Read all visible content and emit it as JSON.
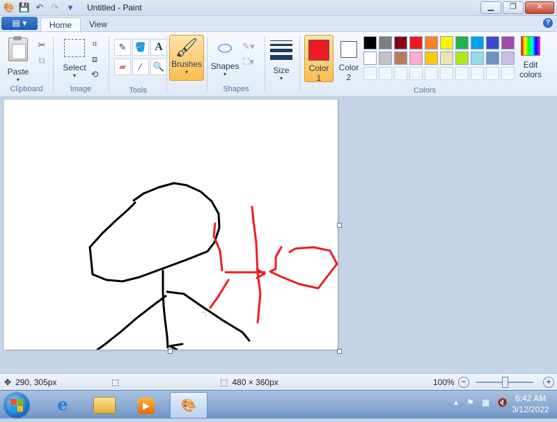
{
  "titlebar": {
    "title": "Untitled - Paint",
    "qat_icons": [
      "paint-app-icon",
      "save-icon",
      "undo-icon",
      "redo-icon",
      "customize-qat-icon"
    ],
    "window_buttons": [
      "minimize",
      "maximize",
      "close"
    ]
  },
  "ribbon_tabs": {
    "menu_icon": "paint-menu",
    "tabs": [
      {
        "label": "Home",
        "active": true
      },
      {
        "label": "View",
        "active": false
      }
    ]
  },
  "groups": {
    "clipboard": {
      "label": "Clipboard",
      "paste_label": "Paste",
      "small_icons": [
        "cut-icon",
        "copy-icon"
      ]
    },
    "image": {
      "label": "Image",
      "select_label": "Select",
      "small_icons": [
        "crop-icon",
        "resize-icon",
        "rotate-icon"
      ]
    },
    "tools": {
      "label": "Tools",
      "icons": [
        "pencil-icon",
        "fill-icon",
        "text-icon",
        "eraser-icon",
        "color-picker-icon",
        "magnifier-icon"
      ]
    },
    "brushes": {
      "label": "Brushes"
    },
    "shapes": {
      "label": "Shapes",
      "button_label": "Shapes"
    },
    "size": {
      "label": "Size"
    },
    "colors": {
      "label": "Colors",
      "color1_label": "Color",
      "color1_num": "1",
      "color2_label": "Color",
      "color2_num": "2",
      "edit_label": "Edit",
      "edit_label2": "colors",
      "color1": "#ed1c24",
      "color2": "#ffffff",
      "palette_row1": [
        "#000000",
        "#7f7f7f",
        "#880015",
        "#ed1c24",
        "#ff7f27",
        "#fff200",
        "#22b14c",
        "#00a2e8",
        "#3f48cc",
        "#a349a4"
      ],
      "palette_row2": [
        "#ffffff",
        "#c3c3c3",
        "#b97a57",
        "#ffaec9",
        "#ffc90e",
        "#efe4b0",
        "#b5e61d",
        "#99d9ea",
        "#7092be",
        "#c8bfe7"
      ]
    }
  },
  "canvas": {
    "strokes": [
      {
        "color": "#000000",
        "name": "head-stroke"
      },
      {
        "color": "#000000",
        "name": "body-stroke"
      },
      {
        "color": "#000000",
        "name": "left-leg-stroke"
      },
      {
        "color": "#000000",
        "name": "right-leg-stroke"
      },
      {
        "color": "#ed1c24",
        "name": "red-vertical-line-left"
      },
      {
        "color": "#ed1c24",
        "name": "red-vertical-line-right"
      },
      {
        "color": "#ed1c24",
        "name": "red-arrow-stroke"
      },
      {
        "color": "#ed1c24",
        "name": "red-loop-stroke"
      }
    ]
  },
  "statusbar": {
    "cursor_pos": "290, 305px",
    "selection_size": "",
    "canvas_size": "480 × 360px",
    "zoom": "100%"
  },
  "taskbar": {
    "apps": [
      "internet-explorer",
      "windows-explorer",
      "media-player",
      "paint"
    ],
    "time": "6:42 AM",
    "date": "3/12/2022"
  }
}
